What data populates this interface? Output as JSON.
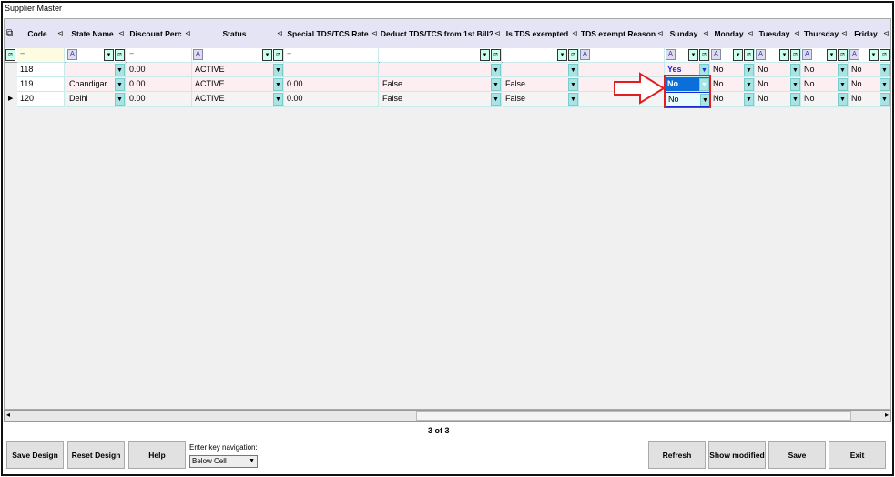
{
  "window_title": "Supplier Master",
  "columns": [
    {
      "label": "Code"
    },
    {
      "label": "State Name"
    },
    {
      "label": "Discount Perc"
    },
    {
      "label": "Status"
    },
    {
      "label": "Special TDS/TCS Rate"
    },
    {
      "label": "Deduct TDS/TCS from 1st Bill?"
    },
    {
      "label": "Is TDS exempted"
    },
    {
      "label": "TDS exempt Reason"
    },
    {
      "label": "Sunday"
    },
    {
      "label": "Monday"
    },
    {
      "label": "Tuesday"
    },
    {
      "label": "Thursday"
    },
    {
      "label": "Friday"
    }
  ],
  "filter_op": "=",
  "rows": [
    {
      "code": "118",
      "state": "",
      "discount": "0.00",
      "status": "ACTIVE",
      "special": "",
      "deduct": "",
      "exempted": "",
      "reason": "",
      "sunday": "Yes",
      "monday": "No",
      "tuesday": "No",
      "thursday": "No",
      "friday": "No"
    },
    {
      "code": "119",
      "state": "Chandigar",
      "discount": "0.00",
      "status": "ACTIVE",
      "special": "0.00",
      "deduct": "False",
      "exempted": "False",
      "reason": "",
      "sunday": "No",
      "monday": "No",
      "tuesday": "No",
      "thursday": "No",
      "friday": "No"
    },
    {
      "code": "120",
      "state": "Delhi",
      "discount": "0.00",
      "status": "ACTIVE",
      "special": "0.00",
      "deduct": "False",
      "exempted": "False",
      "reason": "",
      "sunday": "No",
      "monday": "No",
      "tuesday": "No",
      "thursday": "No",
      "friday": "No"
    }
  ],
  "record_counter": "3 of 3",
  "footer": {
    "save_design": "Save Design",
    "reset_design": "Reset Design",
    "help": "Help",
    "enter_key_label": "Enter key navigation:",
    "enter_key_value": "Below Cell",
    "refresh": "Refresh",
    "show_modified": "Show modified",
    "save": "Save",
    "exit": "Exit"
  },
  "colors": {
    "header_bg": "#e4e4f4",
    "pink_row": "#fdeef2",
    "selected": "#0a6fd8",
    "annotation": "#e02020"
  }
}
